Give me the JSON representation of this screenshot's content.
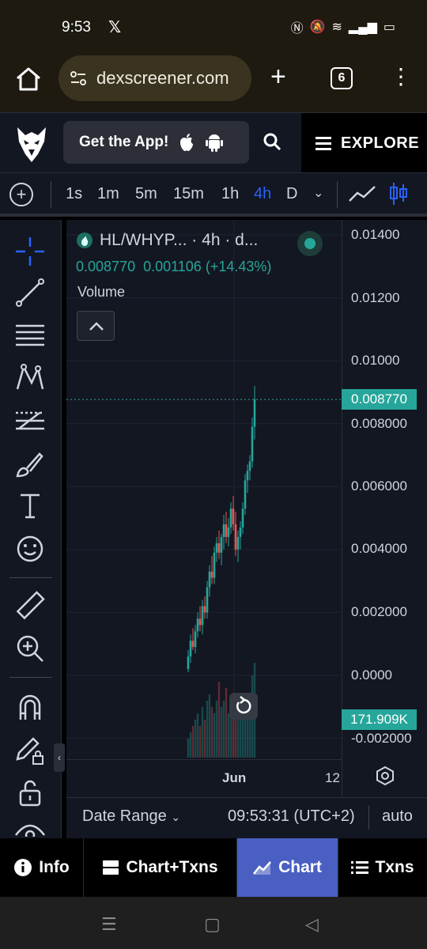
{
  "status_bar": {
    "time": "9:53",
    "app_icon": "x-icon"
  },
  "browser": {
    "url": "dexscreener.com",
    "tab_count": "6"
  },
  "header": {
    "get_app_label": "Get the App!",
    "explore_label": "EXPLORE"
  },
  "timeframes": [
    "1s",
    "1m",
    "5m",
    "15m",
    "1h",
    "4h",
    "D"
  ],
  "active_timeframe": "4h",
  "chart": {
    "pair_title": "HL/WHYP... · 4h · d...",
    "ohlc": "0.008770  0.001106 (+14.43%)",
    "volume_label": "Volume",
    "price_labels": [
      "0.01400",
      "0.01200",
      "0.01000",
      "0.008000",
      "0.006000",
      "0.004000",
      "0.002000",
      "0.0000",
      "-0.002000"
    ],
    "last_price_tag": "0.008770",
    "volume_tag": "171.909K",
    "time_labels": [
      "Jun",
      "12"
    ]
  },
  "range_bar": {
    "date_range": "Date Range",
    "time": "09:53:31 (UTC+2)",
    "scale": "auto"
  },
  "bottom_tabs": [
    {
      "label": "Info",
      "icon": "info-icon"
    },
    {
      "label": "Chart+Txns",
      "icon": "split-icon"
    },
    {
      "label": "Chart",
      "icon": "chart-icon"
    },
    {
      "label": "Txns",
      "icon": "list-icon"
    }
  ],
  "active_tab": "Chart",
  "colors": {
    "up": "#26a69a",
    "down": "#ef5350",
    "accent": "#2962ff",
    "active_tab": "#4a5fc1"
  },
  "chart_data": {
    "type": "candlestick",
    "y_range": [
      -0.002,
      0.014
    ],
    "last_price": 0.00877,
    "candles": [
      {
        "o": 0.0002,
        "h": 0.0008,
        "l": 0.0001,
        "c": 0.0006
      },
      {
        "o": 0.0006,
        "h": 0.0013,
        "l": 0.0004,
        "c": 0.0011
      },
      {
        "o": 0.0011,
        "h": 0.0015,
        "l": 0.0008,
        "c": 0.0009
      },
      {
        "o": 0.0009,
        "h": 0.0016,
        "l": 0.0007,
        "c": 0.0014
      },
      {
        "o": 0.0014,
        "h": 0.002,
        "l": 0.0012,
        "c": 0.0018
      },
      {
        "o": 0.0018,
        "h": 0.0022,
        "l": 0.0014,
        "c": 0.0016
      },
      {
        "o": 0.0016,
        "h": 0.0024,
        "l": 0.0013,
        "c": 0.0022
      },
      {
        "o": 0.0022,
        "h": 0.0025,
        "l": 0.0018,
        "c": 0.002
      },
      {
        "o": 0.002,
        "h": 0.003,
        "l": 0.0018,
        "c": 0.0028
      },
      {
        "o": 0.0028,
        "h": 0.0035,
        "l": 0.0025,
        "c": 0.0033
      },
      {
        "o": 0.0033,
        "h": 0.0038,
        "l": 0.0029,
        "c": 0.0031
      },
      {
        "o": 0.0031,
        "h": 0.0041,
        "l": 0.0029,
        "c": 0.0039
      },
      {
        "o": 0.0039,
        "h": 0.0044,
        "l": 0.0036,
        "c": 0.0042
      },
      {
        "o": 0.0042,
        "h": 0.0046,
        "l": 0.0037,
        "c": 0.0039
      },
      {
        "o": 0.0039,
        "h": 0.0045,
        "l": 0.0035,
        "c": 0.0044
      },
      {
        "o": 0.0044,
        "h": 0.0051,
        "l": 0.004,
        "c": 0.0048
      },
      {
        "o": 0.0048,
        "h": 0.0052,
        "l": 0.0042,
        "c": 0.0044
      },
      {
        "o": 0.0044,
        "h": 0.005,
        "l": 0.0041,
        "c": 0.0047
      },
      {
        "o": 0.0047,
        "h": 0.0055,
        "l": 0.0045,
        "c": 0.0053
      },
      {
        "o": 0.0053,
        "h": 0.0057,
        "l": 0.0046,
        "c": 0.0048
      },
      {
        "o": 0.0048,
        "h": 0.0052,
        "l": 0.0038,
        "c": 0.004
      },
      {
        "o": 0.004,
        "h": 0.0046,
        "l": 0.0036,
        "c": 0.0044
      },
      {
        "o": 0.0044,
        "h": 0.0049,
        "l": 0.004,
        "c": 0.0047
      },
      {
        "o": 0.0047,
        "h": 0.0055,
        "l": 0.0045,
        "c": 0.0053
      },
      {
        "o": 0.0053,
        "h": 0.0064,
        "l": 0.0051,
        "c": 0.0062
      },
      {
        "o": 0.0062,
        "h": 0.0067,
        "l": 0.0058,
        "c": 0.0065
      },
      {
        "o": 0.0065,
        "h": 0.007,
        "l": 0.0062,
        "c": 0.0068
      },
      {
        "o": 0.0068,
        "h": 0.0082,
        "l": 0.0066,
        "c": 0.0079
      },
      {
        "o": 0.0079,
        "h": 0.0092,
        "l": 0.0075,
        "c": 0.00877
      }
    ],
    "volumes": [
      0.3,
      0.4,
      0.5,
      0.6,
      0.7,
      0.5,
      0.8,
      0.6,
      0.9,
      1.0,
      0.8,
      0.7,
      0.9,
      1.2,
      0.8,
      0.9,
      1.1,
      0.7,
      0.8,
      0.9,
      1.0,
      0.6,
      0.7,
      0.9,
      0.8,
      1.0,
      0.9,
      1.3,
      1.5
    ]
  }
}
